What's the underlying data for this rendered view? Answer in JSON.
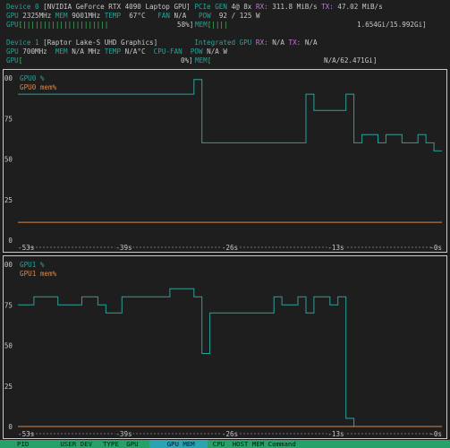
{
  "colors": {
    "background": "#1e1e1e",
    "cyan": "#2aa198",
    "orange": "#d7874a",
    "magenta": "#c678dd",
    "green": "#3fbf5f",
    "footer_bg": "#26a269",
    "footer_highlight": "#2aa4b4"
  },
  "device0": {
    "title_label": "Device 0",
    "name": "[NVIDIA GeForce RTX 4090 Laptop GPU]",
    "pcie_label": "PCIe",
    "gen_label": "GEN",
    "gen_value": "4@ 8x",
    "rx_label": "RX:",
    "rx_value": "311.8 MiB/s",
    "tx_label": "TX:",
    "tx_value": "47.02 MiB/s",
    "gpu_label": "GPU",
    "gpu_clock": "2325MHz",
    "mem_label": "MEM",
    "mem_clock": "9001MHz",
    "temp_label": "TEMP",
    "temp_value": "67°C",
    "fan_label": "FAN",
    "fan_value": "N/A",
    "pow_label": "POW",
    "pow_value": "92 / 125 W",
    "util_label": "GPU",
    "util_bars": "[|||||||||||||||||||||",
    "util_value": "58%]",
    "mem_bar_label": "MEM",
    "mem_bars": "[||||",
    "mem_value": "1.654Gi/15.992Gi]"
  },
  "device1": {
    "title_label": "Device 1",
    "name": "[Raptor Lake-S UHD Graphics]",
    "integrated_label": "Integrated GPU",
    "rx_label": "RX:",
    "rx_value": "N/A",
    "tx_label": "TX:",
    "tx_value": "N/A",
    "gpu_label": "GPU",
    "gpu_clock": "700MHz",
    "mem_label": "MEM",
    "mem_clock": "N/A MHz",
    "temp_label": "TEMP",
    "temp_value": "N/A°C",
    "cpufan_label": "CPU-FAN",
    "pow_label": "POW",
    "pow_value": "N/A W",
    "util_label": "GPU",
    "util_bars": "[",
    "util_value": "0%]",
    "mem_bar_label": "MEM",
    "mem_bars": "[",
    "mem_value": "N/A/62.471Gi]"
  },
  "chart_data": [
    {
      "type": "line",
      "x_unit": "seconds ago",
      "xlim": [
        -53,
        0
      ],
      "ylim": [
        0,
        100
      ],
      "ytick_labels": [
        "100",
        "75",
        "50",
        "25",
        "0"
      ],
      "xtick_labels": [
        "53s",
        "39s",
        "26s",
        "13s",
        "0s"
      ],
      "series": [
        {
          "name": "GPU0 %",
          "color": "#2aa198",
          "x": [
            -53,
            -48,
            -48,
            -47,
            -47,
            -34,
            -34,
            -31,
            -31,
            -30,
            -30,
            -17,
            -17,
            -16,
            -16,
            -12,
            -12,
            -11,
            -11,
            -10,
            -10,
            -8,
            -8,
            -7,
            -7,
            -5,
            -5,
            -3,
            -3,
            -2,
            -2,
            -1,
            -1,
            0
          ],
          "y": [
            90,
            90,
            90,
            90,
            90,
            90,
            90,
            90,
            99,
            99,
            60,
            60,
            90,
            90,
            80,
            80,
            90,
            90,
            60,
            60,
            65,
            65,
            60,
            60,
            65,
            65,
            60,
            60,
            65,
            65,
            60,
            60,
            55,
            55
          ]
        },
        {
          "name": "GPU0 mem%",
          "color": "#d7874a",
          "x": [
            -53,
            0
          ],
          "y": [
            11,
            11
          ]
        }
      ]
    },
    {
      "type": "line",
      "x_unit": "seconds ago",
      "xlim": [
        -53,
        0
      ],
      "ylim": [
        0,
        100
      ],
      "ytick_labels": [
        "100",
        "75",
        "50",
        "25",
        "0"
      ],
      "xtick_labels": [
        "53s",
        "39s",
        "26s",
        "13s",
        "0s"
      ],
      "series": [
        {
          "name": "GPU1 %",
          "color": "#2aa198",
          "x": [
            -53,
            -51,
            -51,
            -48,
            -48,
            -45,
            -45,
            -43,
            -43,
            -42,
            -42,
            -40,
            -40,
            -34,
            -34,
            -31,
            -31,
            -30,
            -30,
            -29,
            -29,
            -21,
            -21,
            -20,
            -20,
            -18,
            -18,
            -17,
            -17,
            -16,
            -16,
            -14,
            -14,
            -13,
            -13,
            -12,
            -12,
            -11,
            -11,
            0
          ],
          "y": [
            75,
            75,
            80,
            80,
            75,
            75,
            80,
            80,
            75,
            75,
            70,
            70,
            80,
            80,
            85,
            85,
            80,
            80,
            45,
            45,
            70,
            70,
            80,
            80,
            75,
            75,
            80,
            80,
            70,
            70,
            80,
            80,
            75,
            75,
            80,
            80,
            5,
            5,
            0,
            0
          ]
        },
        {
          "name": "GPU1 mem%",
          "color": "#d7874a",
          "x": [
            -53,
            0
          ],
          "y": [
            0,
            0
          ]
        }
      ]
    }
  ],
  "footer": {
    "pid": "PID",
    "user": "USER",
    "dev": "DEV",
    "type": "TYPE",
    "gpu": "GPU",
    "gpu_mem": "GPU MEM",
    "cpu": "CPU",
    "host_mem": "HOST MEM",
    "command": "Command"
  }
}
